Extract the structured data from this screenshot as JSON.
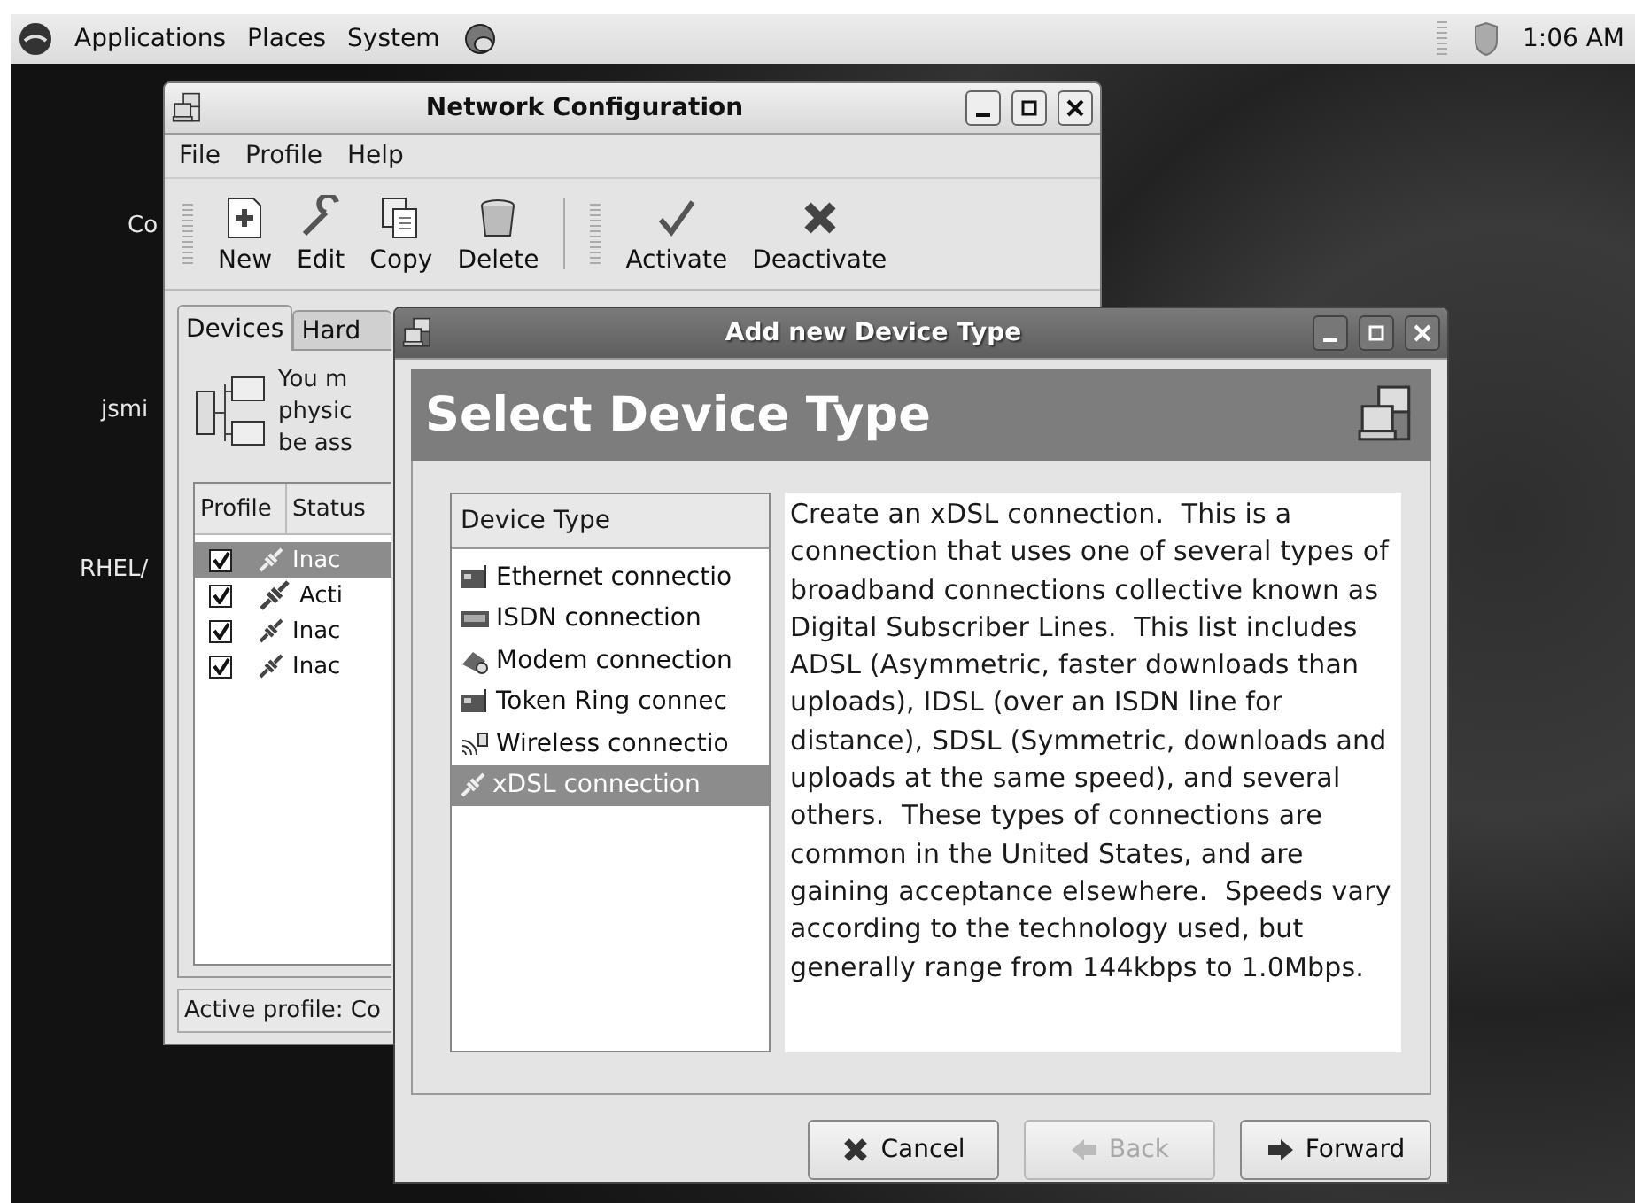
{
  "top_panel": {
    "menus": [
      "Applications",
      "Places",
      "System"
    ],
    "clock": "1:06 AM"
  },
  "desktop_icons": [
    {
      "label": "Co"
    },
    {
      "label": "jsmi"
    },
    {
      "label": "RHEL/"
    }
  ],
  "network_window": {
    "title": "Network Configuration",
    "menus": [
      "File",
      "Profile",
      "Help"
    ],
    "toolbar_groups": [
      [
        "New",
        "Edit",
        "Copy",
        "Delete"
      ],
      [
        "Activate",
        "Deactivate"
      ]
    ],
    "tabs": [
      {
        "label": "Devices",
        "selected": true
      },
      {
        "label": "Hard",
        "selected": false
      }
    ],
    "info_lines": [
      "You m",
      "physic",
      "be ass"
    ],
    "columns": [
      "Profile",
      "Status"
    ],
    "rows": [
      {
        "checked": true,
        "status": "Inac",
        "active": false,
        "selected": true
      },
      {
        "checked": true,
        "status": "Acti",
        "active": true,
        "selected": false
      },
      {
        "checked": true,
        "status": "Inac",
        "active": false,
        "selected": false
      },
      {
        "checked": true,
        "status": "Inac",
        "active": false,
        "selected": false
      }
    ],
    "status_bar": "Active profile: Co"
  },
  "dialog": {
    "title": "Add new Device Type",
    "heading": "Select Device Type",
    "list_header": "Device Type",
    "items": [
      {
        "label": "Ethernet connectio",
        "kind": "card",
        "selected": false
      },
      {
        "label": "ISDN connection",
        "kind": "isdn",
        "selected": false
      },
      {
        "label": "Modem connection",
        "kind": "modem",
        "selected": false
      },
      {
        "label": "Token Ring connec",
        "kind": "card",
        "selected": false
      },
      {
        "label": "Wireless connectio",
        "kind": "wireless",
        "selected": false
      },
      {
        "label": "xDSL connection",
        "kind": "plug",
        "selected": true
      }
    ],
    "description": "Create an xDSL connection.  This is a connection that uses one of several types of broadband connections collective known as Digital Subscriber Lines.  This list includes ADSL (Asymmetric, faster downloads than uploads), IDSL (over an ISDN line for distance), SDSL (Symmetric, downloads and uploads at the same speed), and several others.  These types of connections are common in the United States, and are gaining acceptance elsewhere.  Speeds vary according to the technology used, but generally range from 144kbps to 1.0Mbps.",
    "buttons": [
      {
        "label": "Cancel",
        "kind": "cancel",
        "disabled": false
      },
      {
        "label": "Back",
        "kind": "back",
        "disabled": true
      },
      {
        "label": "Forward",
        "kind": "forward",
        "disabled": false
      }
    ]
  }
}
